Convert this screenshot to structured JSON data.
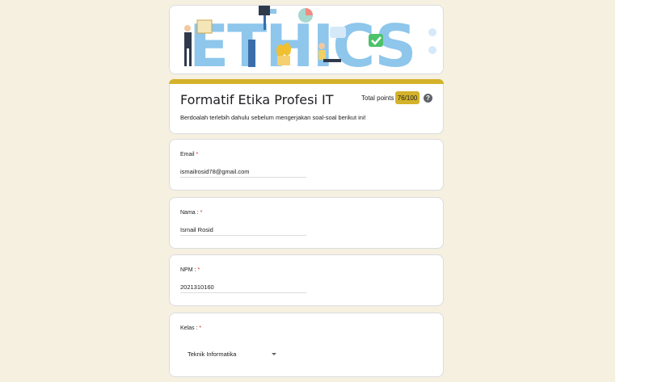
{
  "banner": {
    "text": "ETHICS"
  },
  "form": {
    "title": "Formatif Etika Profesi IT",
    "total_points_label": "Total points",
    "score": "76/100",
    "help_icon": "?",
    "description": "Berdoalah terlebih dahulu sebelum mengerjakan soal-soal berikut ini!"
  },
  "questions": {
    "email": {
      "label": "Email",
      "required": "*",
      "value": "ismailrosid78@gmail.com"
    },
    "nama": {
      "label": "Nama :",
      "required": "*",
      "value": "Ismail Rosid"
    },
    "npm": {
      "label": "NPM :",
      "required": "*",
      "value": "2021310160"
    },
    "kelas": {
      "label": "Kelas :",
      "required": "*",
      "value": "Teknik Informatika"
    }
  },
  "colors": {
    "page_background": "#f6f0e0",
    "accent": "#d4b22a",
    "banner_letters": "#8ec6ec",
    "required": "#d93025"
  },
  "icons": [
    "help-icon",
    "chevron-down-icon",
    "checkmark-icon"
  ]
}
